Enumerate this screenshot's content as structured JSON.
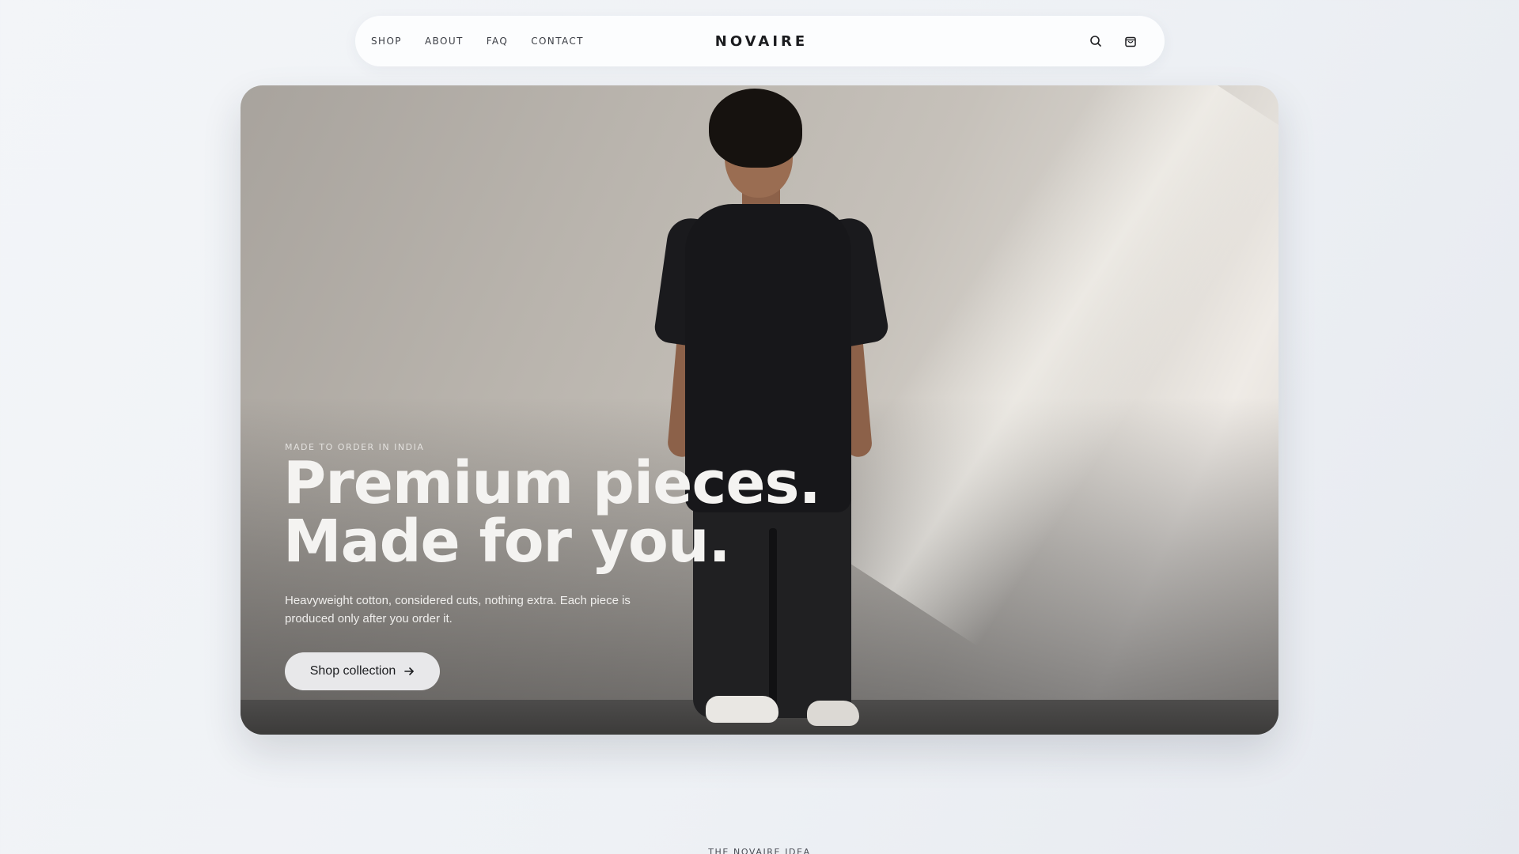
{
  "nav": {
    "links": [
      "SHOP",
      "ABOUT",
      "FAQ",
      "CONTACT"
    ],
    "brand": "NOVAIRE",
    "icons": [
      "search-icon",
      "shopping-bag-icon"
    ]
  },
  "hero": {
    "eyebrow": "MADE TO ORDER IN INDIA",
    "headline_line1": "Premium pieces.",
    "headline_line2": "Made for you.",
    "description": "Heavyweight cotton, considered cuts, nothing extra. Each piece is produced only after you order it.",
    "cta_label": "Shop collection",
    "cta_icon": "arrow-right-icon"
  },
  "section": {
    "eyebrow": "THE NOVAIRE IDEA"
  },
  "colors": {
    "background": "#eef1f5",
    "nav_background": "#fcfdfe",
    "cta_background": "#e8e8ea",
    "text_dark": "#1c1d20"
  }
}
